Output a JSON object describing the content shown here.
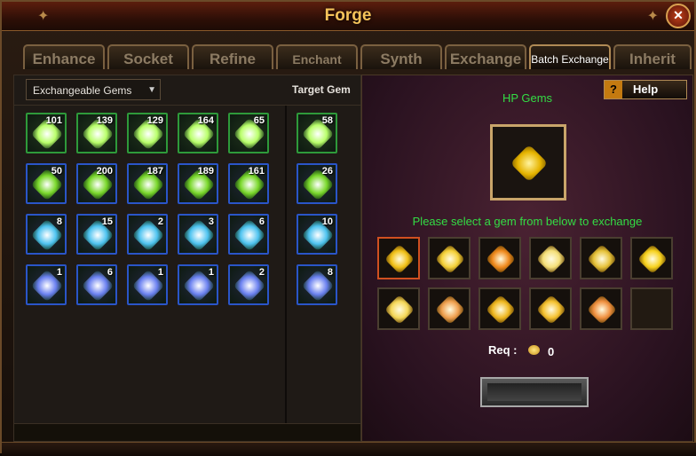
{
  "window": {
    "title": "Forge"
  },
  "tabs": [
    {
      "label": "Enhance"
    },
    {
      "label": "Socket"
    },
    {
      "label": "Refine"
    },
    {
      "label": "Enchant"
    },
    {
      "label": "Synth"
    },
    {
      "label": "Exchange"
    },
    {
      "label": "Batch Exchange"
    },
    {
      "label": "Inherit"
    }
  ],
  "active_tab": "Batch Exchange",
  "left_panel": {
    "dropdown_label": "Exchangeable Gems",
    "target_gem_label": "Target Gem",
    "rows": [
      {
        "border": "#2e9a3a",
        "gem_color": "#b9ff6a",
        "gems": [
          "101",
          "139",
          "129",
          "164",
          "65"
        ],
        "target": "58"
      },
      {
        "border": "#2a55c8",
        "gem_color": "#7ad82c",
        "gems": [
          "50",
          "200",
          "187",
          "189",
          "161"
        ],
        "target": "26"
      },
      {
        "border": "#2a55c8",
        "gem_color": "#4ec3f0",
        "gems": [
          "8",
          "15",
          "2",
          "3",
          "6"
        ],
        "target": "10"
      },
      {
        "border": "#2a55c8",
        "gem_color": "#6a80f0",
        "gems": [
          "1",
          "6",
          "1",
          "1",
          "2"
        ],
        "target": "8"
      }
    ]
  },
  "right_panel": {
    "help_label": "Help",
    "title": "HP Gems",
    "hint": "Please select a gem from below to exchange",
    "req_label": "Req :",
    "req_value": "0",
    "gem_slots": [
      {
        "color": "#f2c21a",
        "selected": true
      },
      {
        "color": "#f5d23a"
      },
      {
        "color": "#f08a1e"
      },
      {
        "color": "#f5e07a"
      },
      {
        "color": "#e6c23a"
      },
      {
        "color": "#f7d21e"
      },
      {
        "color": "#f5d85a"
      },
      {
        "color": "#f0a050"
      },
      {
        "color": "#f0b820"
      },
      {
        "color": "#f5c230"
      },
      {
        "color": "#f09040"
      },
      {
        "color": "",
        "empty": true
      }
    ]
  }
}
